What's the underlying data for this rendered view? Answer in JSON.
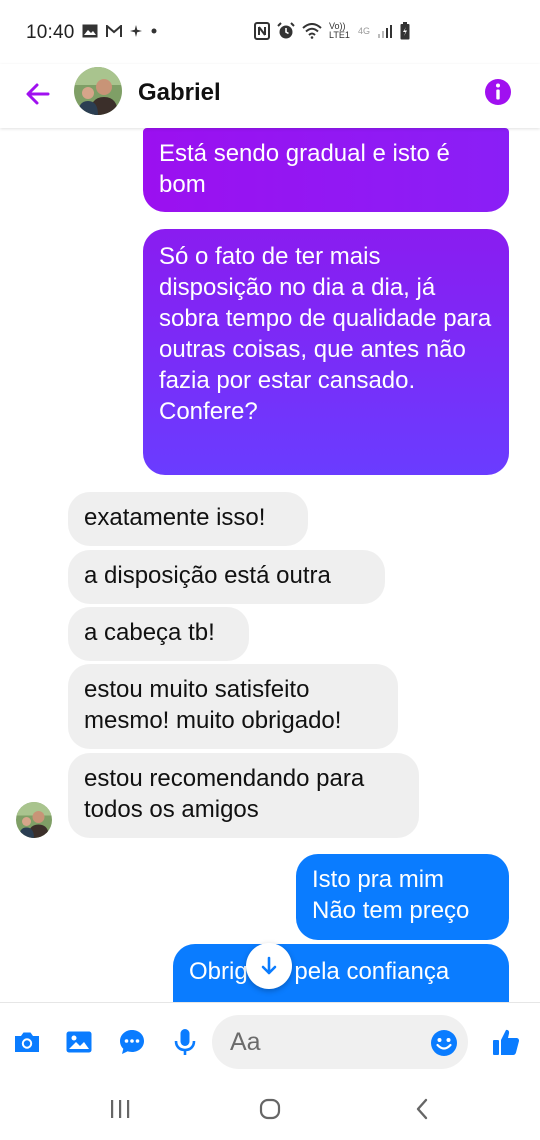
{
  "status_bar": {
    "time": "10:40",
    "network_text": "Vo)) LTE1",
    "network_gen": "4G"
  },
  "header": {
    "contact_name": "Gabriel",
    "accent_color": "#a010f0"
  },
  "messages": [
    {
      "direction": "outgoing",
      "text": "Está sendo gradual e isto é bom"
    },
    {
      "direction": "outgoing",
      "text": "Só o fato de ter mais disposição no dia a dia, já sobra tempo de qualidade para outras coisas, que antes não fazia por estar cansado.\nConfere?"
    },
    {
      "direction": "incoming",
      "text": "exatamente isso!"
    },
    {
      "direction": "incoming",
      "text": "a disposição está outra"
    },
    {
      "direction": "incoming",
      "text": "a cabeça tb!"
    },
    {
      "direction": "incoming",
      "text": "estou muito satisfeito mesmo! muito obrigado!"
    },
    {
      "direction": "incoming",
      "text": "estou recomendando para todos os amigos"
    },
    {
      "direction": "outgoing",
      "text": "Isto pra mim\nNão tem preço"
    },
    {
      "direction": "outgoing",
      "text": "Obrigado pela confiança"
    }
  ],
  "composer": {
    "placeholder": "Aa",
    "icons": [
      "camera-icon",
      "image-icon",
      "chat-bubble-icon",
      "microphone-icon",
      "emoji-icon",
      "thumbs-up-icon"
    ],
    "icon_color": "#0a7cff"
  },
  "nav": {
    "icons": [
      "recent-apps-icon",
      "home-icon",
      "back-icon"
    ]
  }
}
